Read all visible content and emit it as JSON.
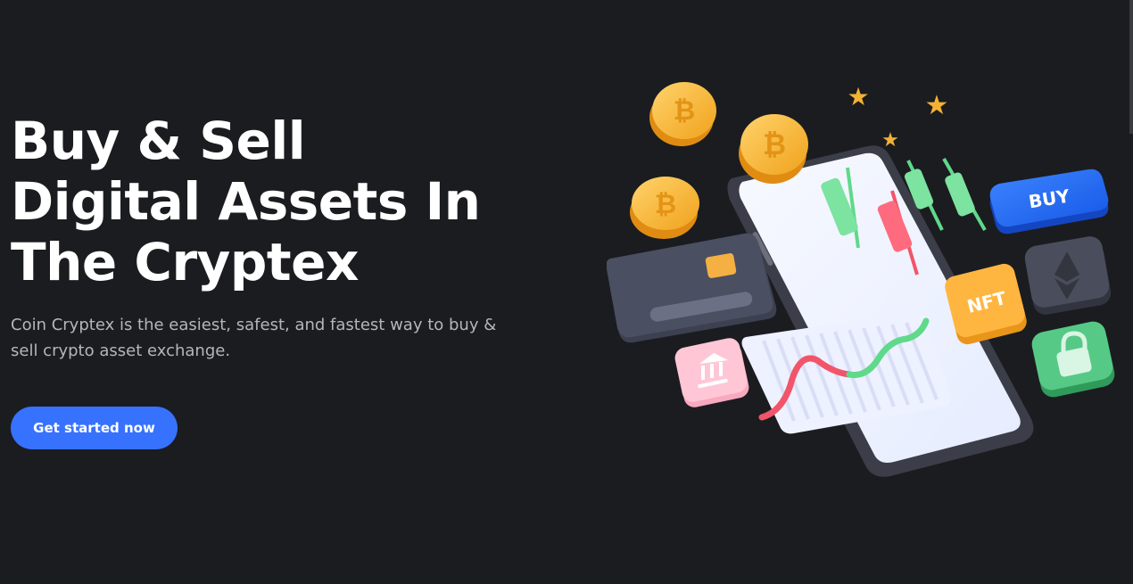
{
  "hero": {
    "title": "Buy & Sell Digital Assets In The Cryptex",
    "subtitle": "Coin Cryptex is the easiest, safest, and fastest way to buy & sell crypto asset exchange.",
    "cta_label": "Get started now"
  },
  "illustration": {
    "buy_tile_label": "BUY",
    "nft_tile_label": "NFT",
    "coin_symbol": "₿",
    "icons": [
      "bitcoin-coin-icon",
      "star-icon",
      "credit-card-icon",
      "bank-icon",
      "ethereum-icon",
      "lock-icon",
      "candlestick-icon",
      "line-chart-icon",
      "smartphone-icon"
    ]
  },
  "colors": {
    "background": "#1b1c20",
    "accent": "#3772ff",
    "title": "#ffffff",
    "subtitle": "#b4b6bd"
  }
}
